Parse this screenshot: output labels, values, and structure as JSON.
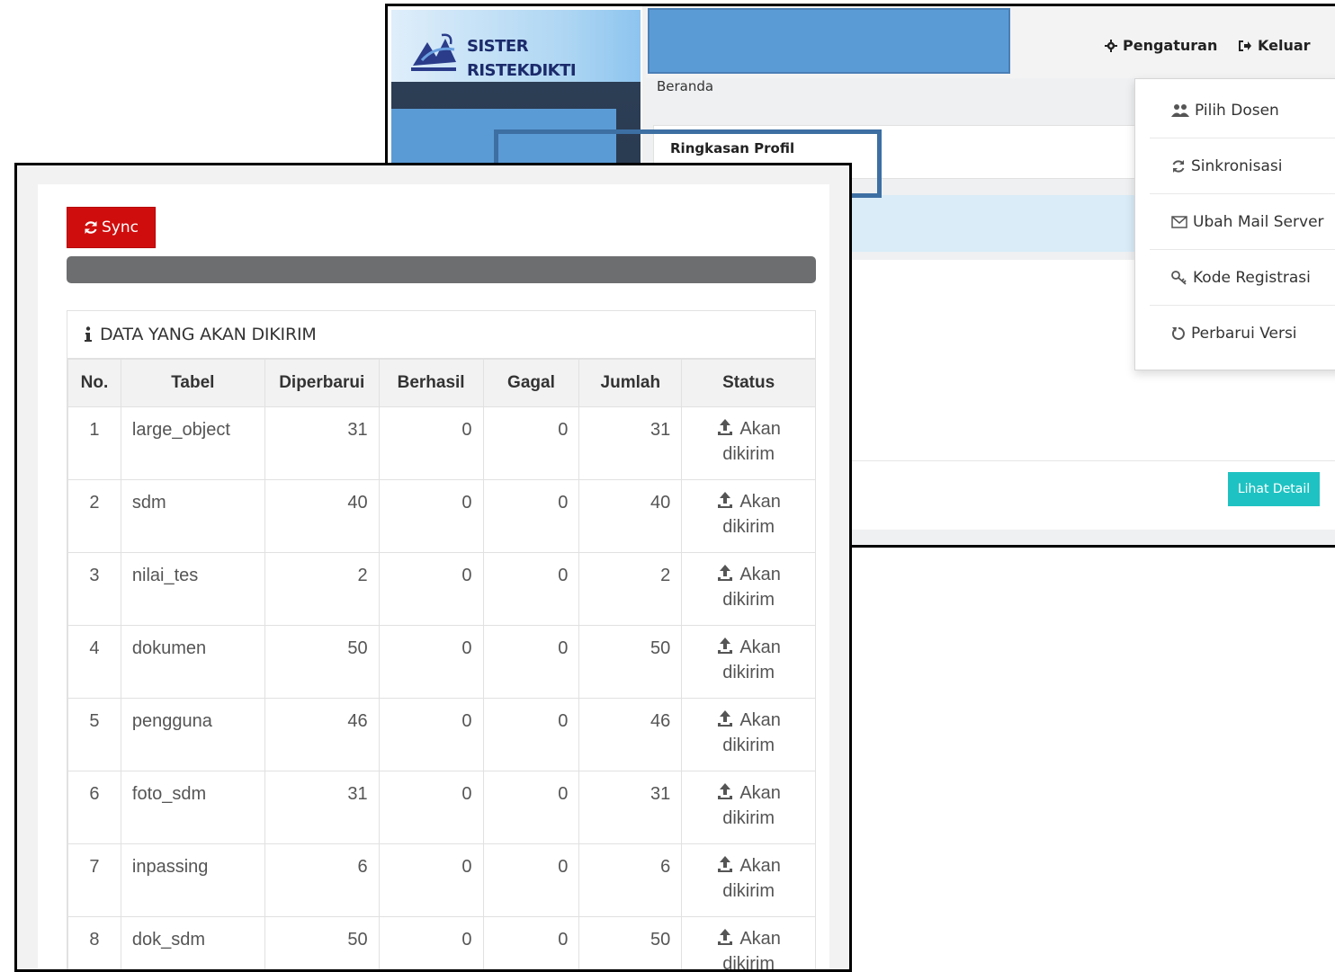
{
  "app": {
    "brand_line1": "SISTER",
    "brand_line2": "RISTEKDIKTI",
    "nav": {
      "settings_label": "Pengaturan",
      "settings_icon": "gear-icon",
      "logout_label": "Keluar",
      "logout_icon": "sign-out-icon"
    },
    "breadcrumb": "Beranda",
    "profile_title": "Ringkasan Profil",
    "detail_button": "Lihat Detail",
    "dropdown": [
      {
        "label": "Pilih Dosen",
        "icon": "users-icon"
      },
      {
        "label": "Sinkronisasi",
        "icon": "refresh-icon"
      },
      {
        "label": "Ubah Mail Server",
        "icon": "envelope-icon"
      },
      {
        "label": "Kode Registrasi",
        "icon": "key-icon"
      },
      {
        "label": "Perbarui Versi",
        "icon": "reload-icon"
      }
    ],
    "highlighted_item": "Sinkronisasi"
  },
  "sync_panel": {
    "sync_button": "Sync",
    "progress": 1.0,
    "box_title": "DATA YANG AKAN DIKIRIM",
    "columns": [
      "No.",
      "Tabel",
      "Diperbarui",
      "Berhasil",
      "Gagal",
      "Jumlah",
      "Status"
    ],
    "rows": [
      {
        "no": "1",
        "tabel": "large_object",
        "diperbarui": "31",
        "berhasil": "0",
        "gagal": "0",
        "jumlah": "31",
        "status_line1": "Akan",
        "status_line2": "dikirim"
      },
      {
        "no": "2",
        "tabel": "sdm",
        "diperbarui": "40",
        "berhasil": "0",
        "gagal": "0",
        "jumlah": "40",
        "status_line1": "Akan",
        "status_line2": "dikirim"
      },
      {
        "no": "3",
        "tabel": "nilai_tes",
        "diperbarui": "2",
        "berhasil": "0",
        "gagal": "0",
        "jumlah": "2",
        "status_line1": "Akan",
        "status_line2": "dikirim"
      },
      {
        "no": "4",
        "tabel": "dokumen",
        "diperbarui": "50",
        "berhasil": "0",
        "gagal": "0",
        "jumlah": "50",
        "status_line1": "Akan",
        "status_line2": "dikirim"
      },
      {
        "no": "5",
        "tabel": "pengguna",
        "diperbarui": "46",
        "berhasil": "0",
        "gagal": "0",
        "jumlah": "46",
        "status_line1": "Akan",
        "status_line2": "dikirim"
      },
      {
        "no": "6",
        "tabel": "foto_sdm",
        "diperbarui": "31",
        "berhasil": "0",
        "gagal": "0",
        "jumlah": "31",
        "status_line1": "Akan",
        "status_line2": "dikirim"
      },
      {
        "no": "7",
        "tabel": "inpassing",
        "diperbarui": "6",
        "berhasil": "0",
        "gagal": "0",
        "jumlah": "6",
        "status_line1": "Akan",
        "status_line2": "dikirim"
      },
      {
        "no": "8",
        "tabel": "dok_sdm",
        "diperbarui": "50",
        "berhasil": "0",
        "gagal": "0",
        "jumlah": "50",
        "status_line1": "Akan",
        "status_line2": "dikirim"
      }
    ]
  },
  "colors": {
    "sync_red": "#d00d0d",
    "progress_gray": "#6d6e70",
    "highlight_blue": "#3d6fa3",
    "redaction_blue": "#5b9bd5",
    "detail_teal": "#1fc2c2"
  }
}
